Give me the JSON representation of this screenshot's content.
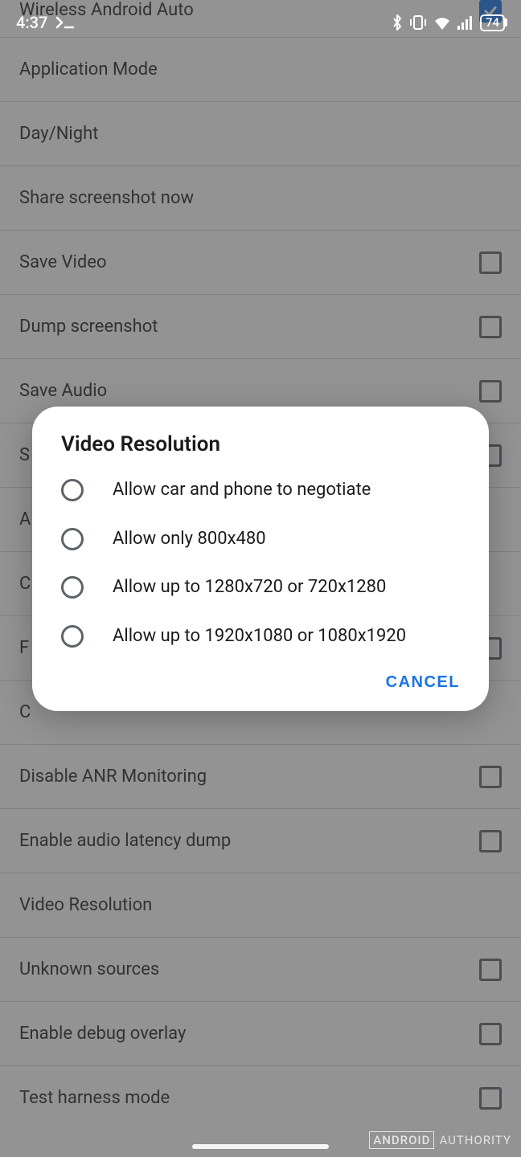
{
  "status": {
    "time": "4:37",
    "battery": "74"
  },
  "settings": {
    "items": [
      {
        "label": "Wireless Android Auto",
        "checkbox": true,
        "checked": true
      },
      {
        "label": "Application Mode",
        "checkbox": false
      },
      {
        "label": "Day/Night",
        "checkbox": false
      },
      {
        "label": "Share screenshot now",
        "checkbox": false
      },
      {
        "label": "Save Video",
        "checkbox": true,
        "checked": false
      },
      {
        "label": "Dump screenshot",
        "checkbox": true,
        "checked": false
      },
      {
        "label": "Save Audio",
        "checkbox": true,
        "checked": false
      },
      {
        "label": "S",
        "checkbox": true,
        "checked": false
      },
      {
        "label": "A",
        "checkbox": false
      },
      {
        "label": "C",
        "checkbox": false
      },
      {
        "label": "F",
        "checkbox": true,
        "checked": false
      },
      {
        "label": "C",
        "checkbox": false
      },
      {
        "label": "Disable ANR Monitoring",
        "checkbox": true,
        "checked": false
      },
      {
        "label": "Enable audio latency dump",
        "checkbox": true,
        "checked": false
      },
      {
        "label": "Video Resolution",
        "checkbox": false
      },
      {
        "label": "Unknown sources",
        "checkbox": true,
        "checked": false
      },
      {
        "label": "Enable debug overlay",
        "checkbox": true,
        "checked": false
      },
      {
        "label": "Test harness mode",
        "checkbox": true,
        "checked": false
      }
    ]
  },
  "dialog": {
    "title": "Video Resolution",
    "options": [
      "Allow car and phone to negotiate",
      "Allow only 800x480",
      "Allow up to 1280x720 or 720x1280",
      "Allow up to 1920x1080 or 1080x1920"
    ],
    "cancel": "Cancel"
  },
  "watermark": {
    "boxed": "ANDROID",
    "rest": "AUTHORITY"
  }
}
